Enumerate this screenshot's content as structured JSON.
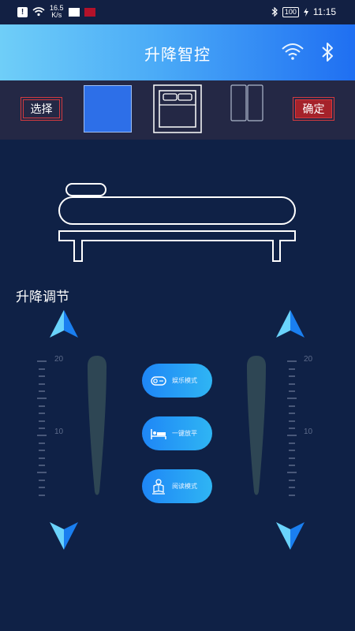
{
  "status_bar": {
    "alert": "!",
    "net_speed_value": "16.5",
    "net_speed_unit": "K/s",
    "battery": "100",
    "time": "11:15"
  },
  "header": {
    "title": "升降智控",
    "icons": [
      "wifi-icon",
      "bluetooth-icon"
    ]
  },
  "selector": {
    "select_label": "选择",
    "confirm_label": "确定",
    "options": [
      "solid-blue",
      "double-bed",
      "split-bed"
    ]
  },
  "section": {
    "title": "升降调节"
  },
  "scale": {
    "top_label": "20",
    "mid_label": "10"
  },
  "modes": [
    {
      "label": "娱乐模式",
      "icon": "entertainment-icon"
    },
    {
      "label": "一键放平",
      "icon": "bed-flat-icon"
    },
    {
      "label": "阅读模式",
      "icon": "reading-icon"
    }
  ],
  "colors": {
    "background": "#0f2146",
    "header_start": "#6fcef8",
    "header_end": "#1f6ff2",
    "accent_red": "#a5222a",
    "accent_blue": "#2d6fe8",
    "arrow_light": "#6ad3fb",
    "arrow_dark": "#1a7ff0",
    "slider": "#2e4654"
  }
}
